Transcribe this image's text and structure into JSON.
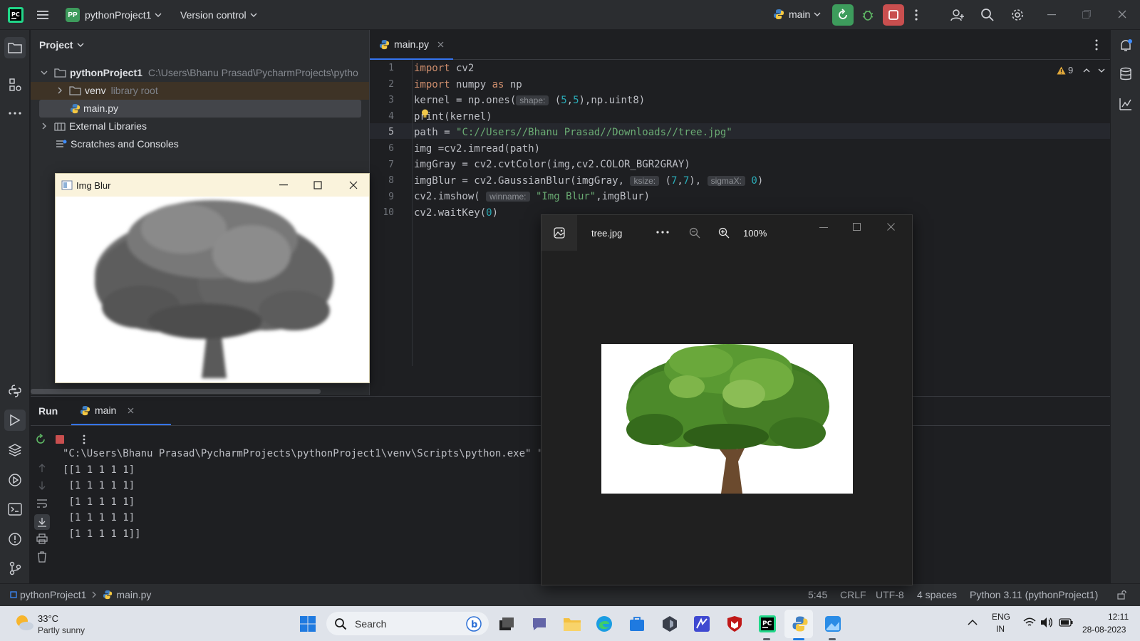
{
  "titlebar": {
    "project_badge": "PP",
    "project_name": "pythonProject1",
    "vcs_label": "Version control",
    "run_config": "main"
  },
  "project_panel": {
    "header": "Project",
    "root_name": "pythonProject1",
    "root_path": "C:\\Users\\Bhanu Prasad\\PycharmProjects\\pytho",
    "venv_name": "venv",
    "venv_hint": "library root",
    "file_name": "main.py",
    "external_libraries": "External Libraries",
    "scratches": "Scratches and Consoles"
  },
  "editor": {
    "tab_label": "main.py",
    "warnings_count": "9",
    "line_numbers": [
      "1",
      "2",
      "3",
      "4",
      "5",
      "6",
      "7",
      "8",
      "9",
      "10"
    ],
    "current_line": 5
  },
  "code": {
    "l1_kw": "import",
    "l1_rest": " cv2",
    "l2_kw": "import",
    "l2_mid": " numpy ",
    "l2_kw2": "as",
    "l2_rest": " np",
    "l3_pre": "kernel = np.ones(",
    "l3_hint": "shape:",
    "l3_open": " (",
    "l3_n1": "5",
    "l3_comma": ",",
    "l3_n2": "5",
    "l3_close": "),np.uint8)",
    "l4_text": "print(kernel)",
    "l5_pre": "path = ",
    "l5_str": "\"C://Users//Bhanu Prasad//Downloads//tree.jpg\"",
    "l6_text": "img =cv2.imread(path)",
    "l7_text": "imgGray = cv2.cvtColor(img,cv2.COLOR_BGR2GRAY)",
    "l8_pre": "imgBlur = cv2.GaussianBlur(imgGray, ",
    "l8_hint1": "ksize:",
    "l8_open": " (",
    "l8_n1": "7",
    "l8_comma": ",",
    "l8_n2": "7",
    "l8_close": "), ",
    "l8_hint2": "sigmaX:",
    "l8_n3": " 0",
    "l8_end": ")",
    "l9_pre": "cv2.imshow( ",
    "l9_hint": "winname:",
    "l9_str": " \"Img Blur\"",
    "l9_end": ",imgBlur)",
    "l10_pre": "cv2.waitKey(",
    "l10_n": "0",
    "l10_end": ")"
  },
  "run_panel": {
    "title": "Run",
    "tab": "main",
    "output": [
      "\"C:\\Users\\Bhanu Prasad\\PycharmProjects\\pythonProject1\\venv\\Scripts\\python.exe\" \"C",
      "[[1 1 1 1 1]",
      " [1 1 1 1 1]",
      " [1 1 1 1 1]",
      " [1 1 1 1 1]",
      " [1 1 1 1 1]]"
    ]
  },
  "statusbar": {
    "crumb_project": "pythonProject1",
    "crumb_file": "main.py",
    "position": "5:45",
    "line_sep": "CRLF",
    "encoding": "UTF-8",
    "indent": "4 spaces",
    "interpreter": "Python 3.11 (pythonProject1)"
  },
  "blur_window": {
    "title": "Img Blur"
  },
  "photos_window": {
    "file_name": "tree.jpg",
    "zoom": "100%"
  },
  "taskbar": {
    "temperature": "33°C",
    "weather": "Partly sunny",
    "search_placeholder": "Search",
    "lang_top": "ENG",
    "lang_bottom": "IN",
    "time": "12:11",
    "date": "28-08-2023"
  },
  "colors": {
    "ide_bg": "#1e1f22",
    "panel_bg": "#2b2d30",
    "run_green": "#3d9c5c",
    "stop_red": "#c94f4f",
    "keyword": "#cf8e6d",
    "string": "#6aab73",
    "number": "#2aacb8"
  }
}
